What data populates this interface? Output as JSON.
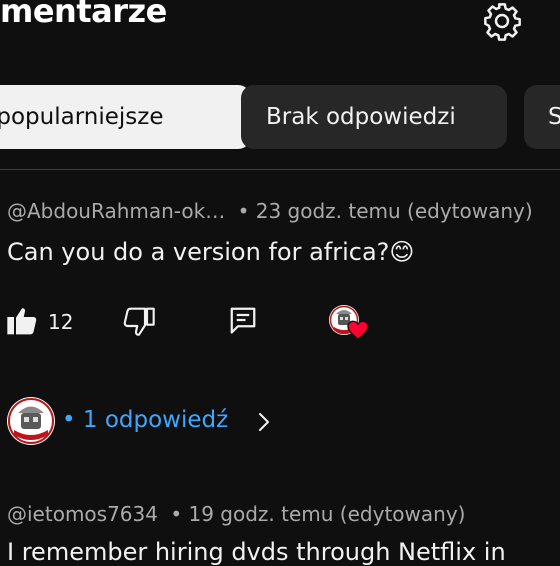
{
  "header": {
    "title": "mentarze"
  },
  "filters": [
    {
      "label": "jpopularniejsze"
    },
    {
      "label": "Brak odpowiedzi"
    },
    {
      "label": "S"
    }
  ],
  "comments": [
    {
      "author": "@AbdouRahman-ok…",
      "time": "• 23 godz. temu (edytowany)",
      "text": "Can you do a version for africa?😊",
      "likes": "12",
      "replies_label": "• 1 odpowiedź"
    },
    {
      "author": "@ietomos7634",
      "time": "• 19 godz. temu (edytowany)",
      "text": "I remember hiring dvds through Netflix in"
    }
  ],
  "icons": {
    "settings": "gear-icon",
    "like": "thumb-up-icon",
    "dislike": "thumb-down-icon",
    "reply": "comment-reply-icon",
    "creator_heart": "creator-heart-icon",
    "chevron": "chevron-right-icon"
  },
  "colors": {
    "background": "#0f0f0f",
    "chip_selected": "#f1f1f1",
    "chip": "#272727",
    "heart": "#ff0033",
    "link": "#3ea6ff"
  }
}
